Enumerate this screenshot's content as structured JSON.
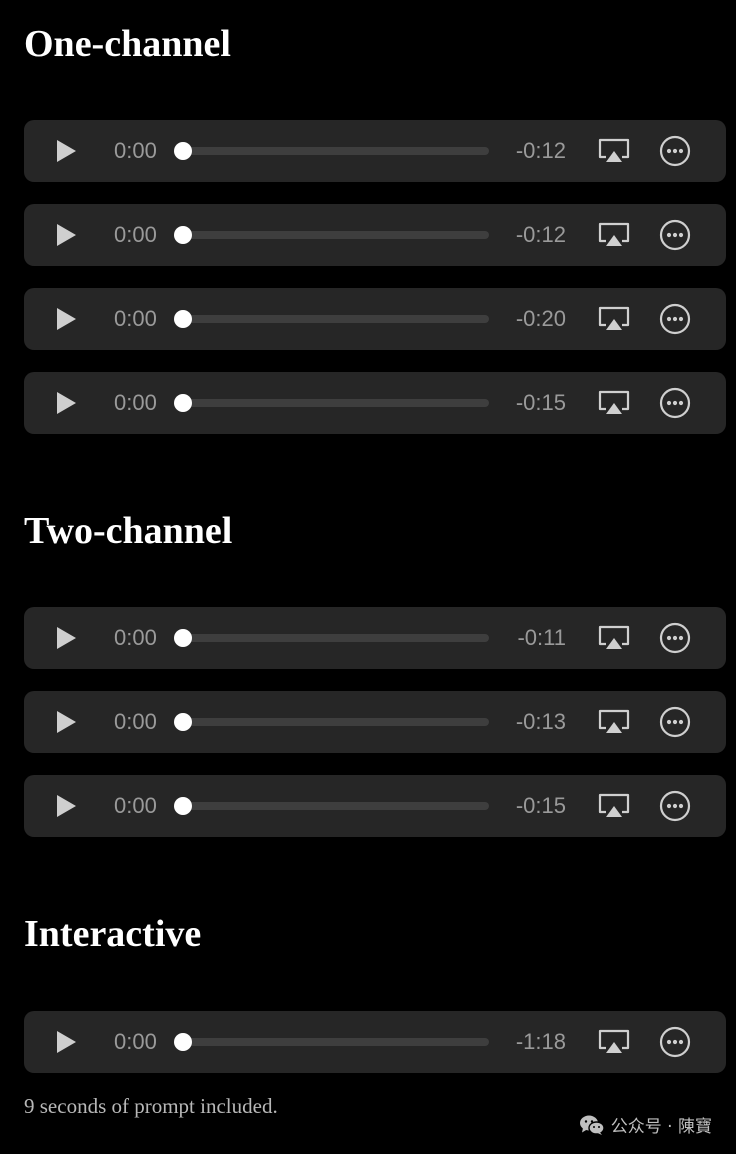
{
  "sections": [
    {
      "title": "One-channel",
      "players": [
        {
          "current": "0:00",
          "remaining": "-0:12"
        },
        {
          "current": "0:00",
          "remaining": "-0:12"
        },
        {
          "current": "0:00",
          "remaining": "-0:20"
        },
        {
          "current": "0:00",
          "remaining": "-0:15"
        }
      ]
    },
    {
      "title": "Two-channel",
      "players": [
        {
          "current": "0:00",
          "remaining": "-0:11"
        },
        {
          "current": "0:00",
          "remaining": "-0:13"
        },
        {
          "current": "0:00",
          "remaining": "-0:15"
        }
      ]
    },
    {
      "title": "Interactive",
      "players": [
        {
          "current": "0:00",
          "remaining": "-1:18"
        }
      ]
    }
  ],
  "caption": "9 seconds of prompt included.",
  "watermark": {
    "text": "公众号 · 陳寶",
    "icon": "wechat-icon"
  },
  "icons": {
    "play": "play-icon",
    "airplay": "airplay-icon",
    "more": "more-options-icon"
  },
  "colors": {
    "background": "#000000",
    "player_background": "#262626",
    "time_text": "#9a9a9a",
    "track": "#3e3e3e",
    "thumb": "#ffffff"
  },
  "progress_fraction": 0
}
